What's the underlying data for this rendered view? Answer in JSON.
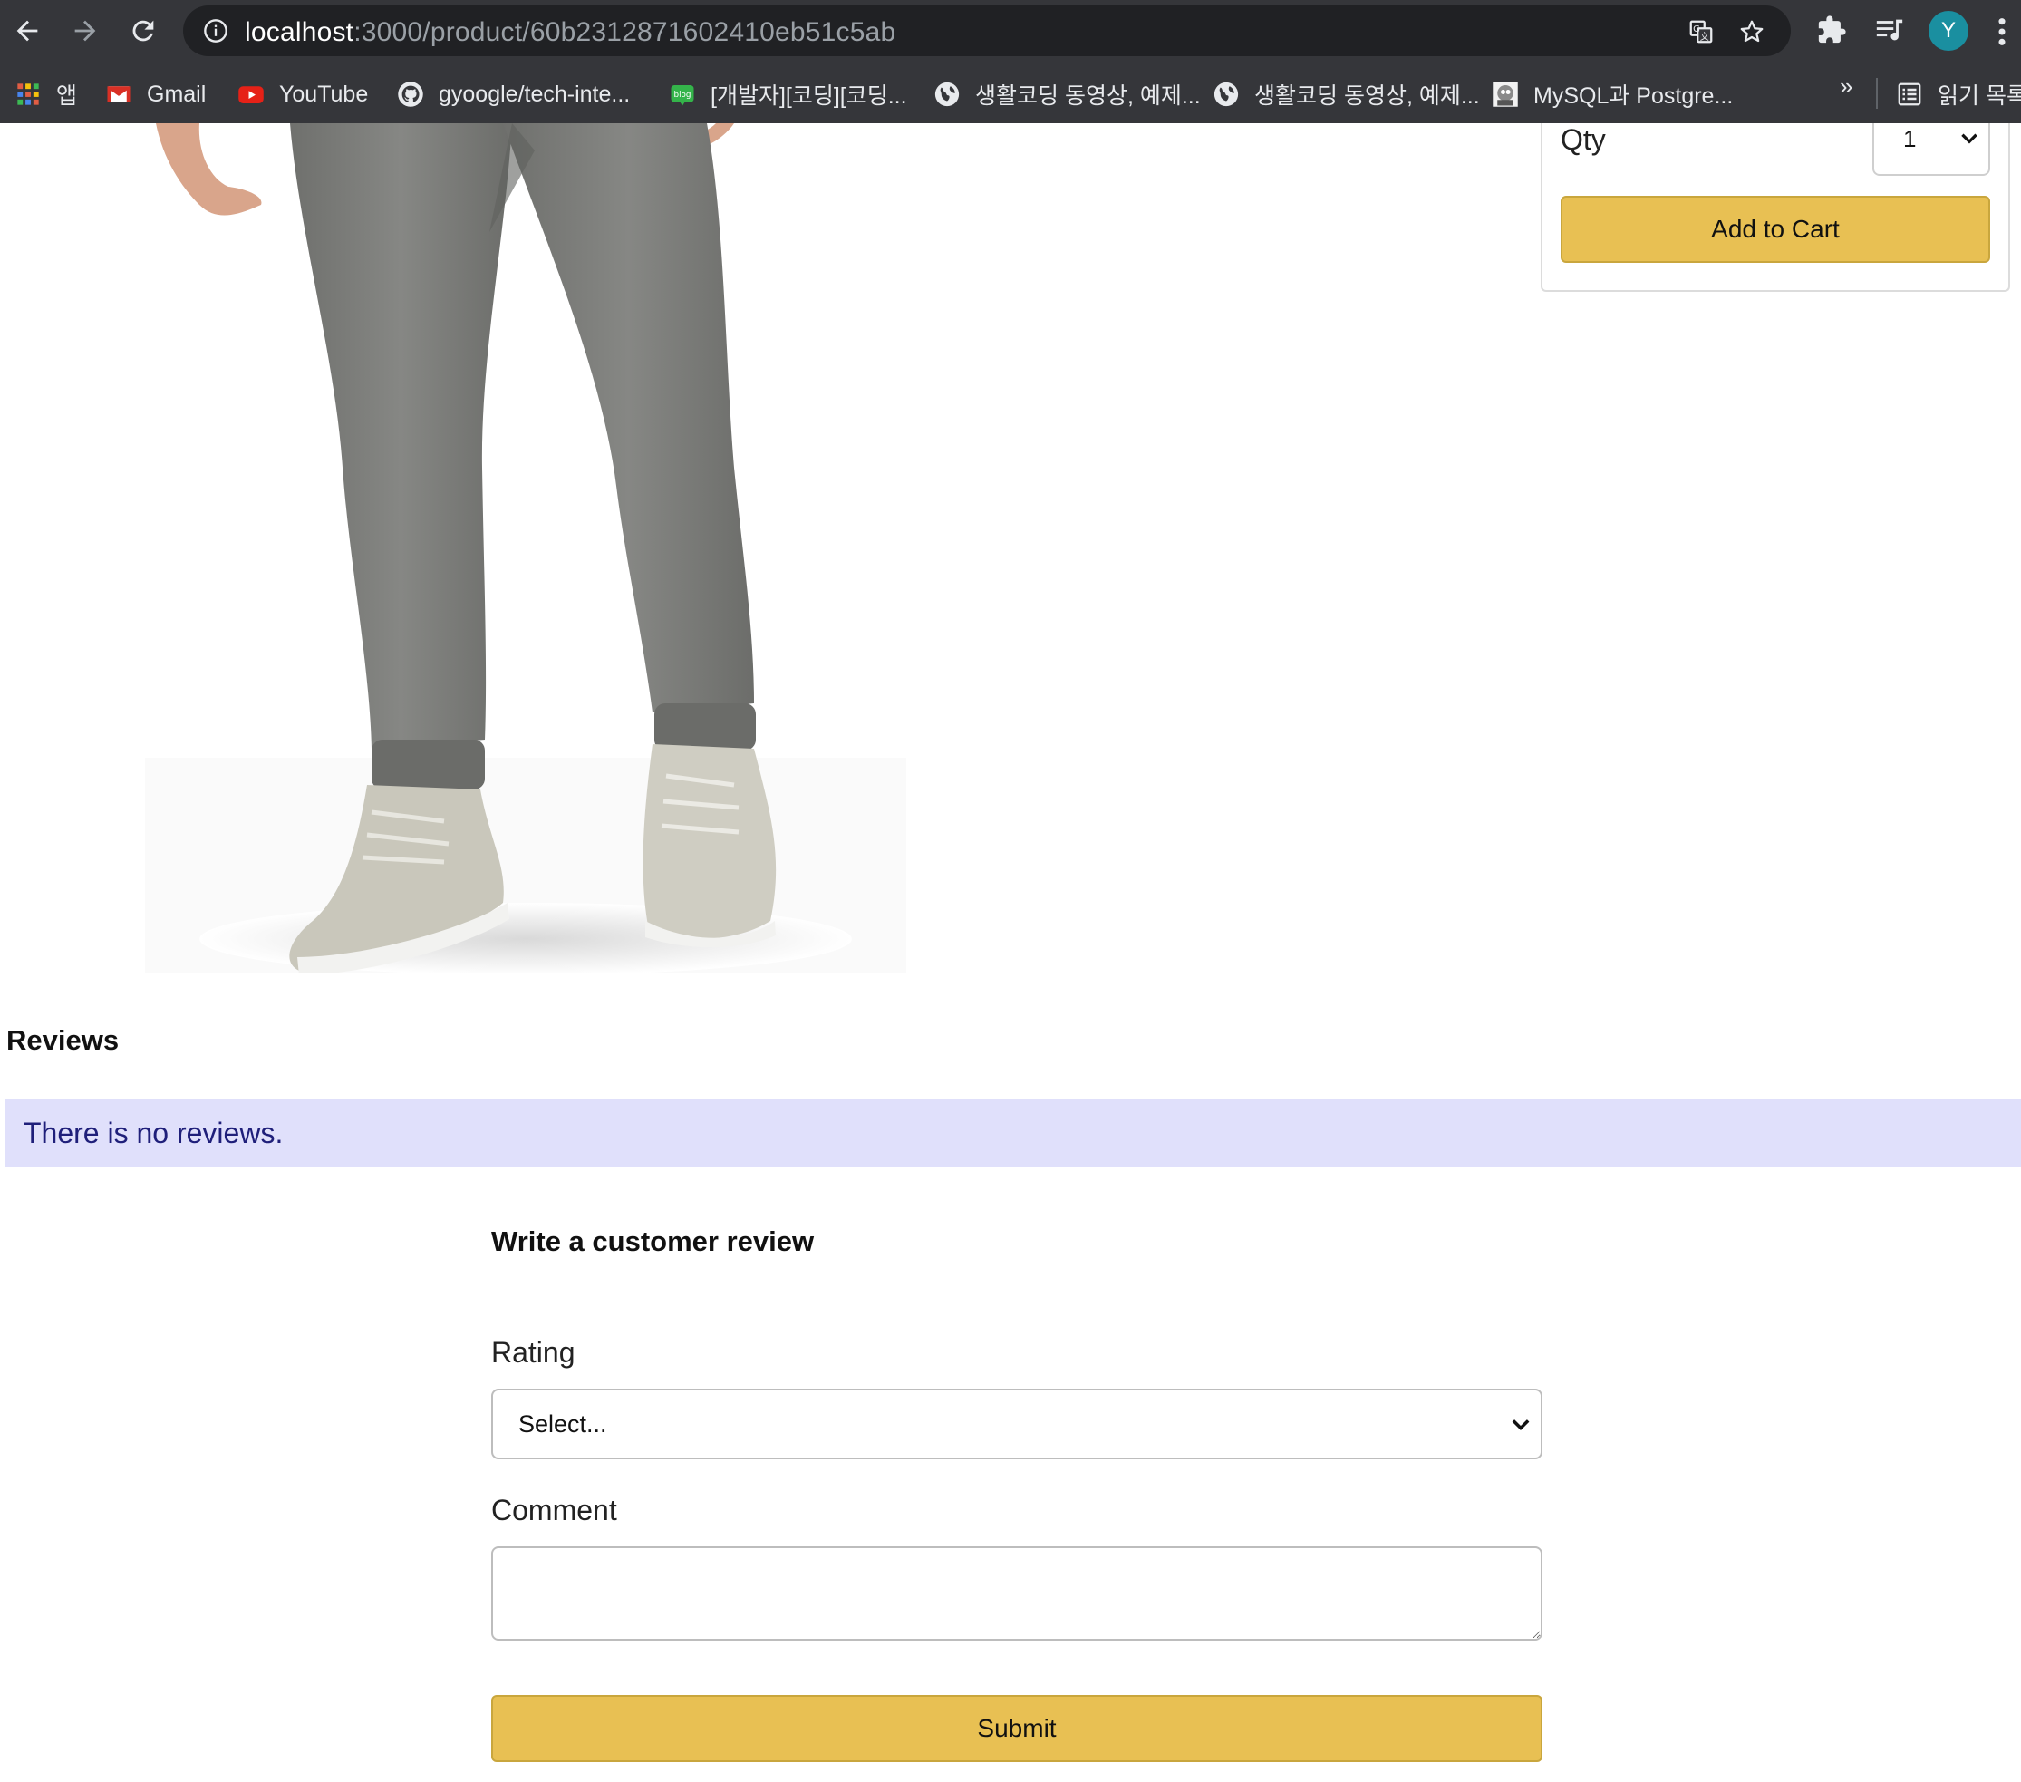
{
  "browser": {
    "url_host": "localhost",
    "url_path": ":3000/product/60b2312871602410eb51c5ab",
    "avatar_letter": "Y",
    "bookmarks": [
      {
        "label": "앱",
        "icon": "apps-grid-icon"
      },
      {
        "label": "Gmail",
        "icon": "gmail-icon"
      },
      {
        "label": "YouTube",
        "icon": "youtube-icon"
      },
      {
        "label": "gyoogle/tech-inte...",
        "icon": "github-icon"
      },
      {
        "label": "[개발자][코딩][코딩...",
        "icon": "blog-icon"
      },
      {
        "label": "생활코딩 동영상, 예제...",
        "icon": "globe-icon"
      },
      {
        "label": "생활코딩 동영상, 예제...",
        "icon": "globe-icon"
      },
      {
        "label": "MySQL과 Postgre...",
        "icon": "site-thumbnail-icon"
      }
    ],
    "more": "»",
    "reading_list": "읽기 목록"
  },
  "product": {
    "qty_label": "Qty",
    "qty_value": "1",
    "add_to_cart": "Add to Cart"
  },
  "reviews": {
    "title": "Reviews",
    "empty_message": "There is no reviews.",
    "form": {
      "title": "Write a customer review",
      "rating_label": "Rating",
      "rating_value": "Select...",
      "comment_label": "Comment",
      "comment_value": "",
      "submit": "Submit"
    }
  },
  "colors": {
    "accent_button": "#e8c053",
    "info_banner_bg": "#e0e0fb",
    "info_banner_text": "#1f1f7a",
    "chrome_bg": "#35363a"
  }
}
